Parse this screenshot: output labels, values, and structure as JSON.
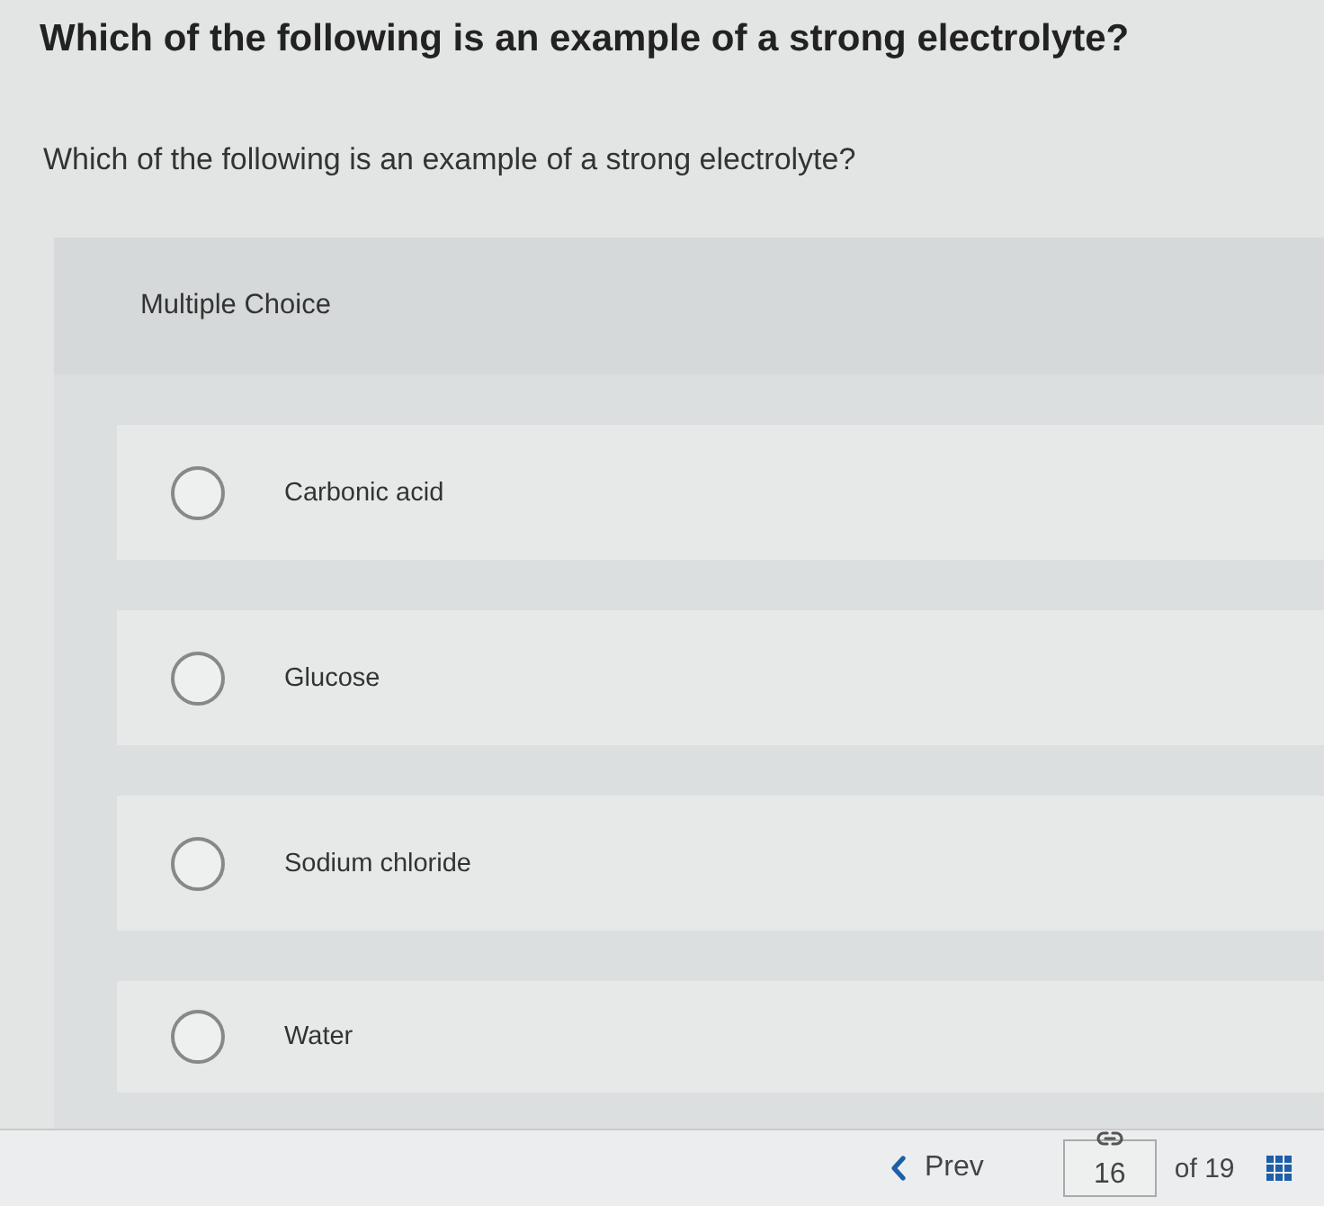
{
  "title": "Which of the following is an example of a strong electrolyte?",
  "question": "Which of the following is an example of a strong electrolyte?",
  "section": {
    "label": "Multiple Choice"
  },
  "options": [
    {
      "label": "Carbonic acid",
      "selected": false
    },
    {
      "label": "Glucose",
      "selected": false
    },
    {
      "label": "Sodium chloride",
      "selected": false
    },
    {
      "label": "Water",
      "selected": false
    }
  ],
  "footer": {
    "prev": "Prev",
    "page": "16",
    "total": "of 19"
  }
}
